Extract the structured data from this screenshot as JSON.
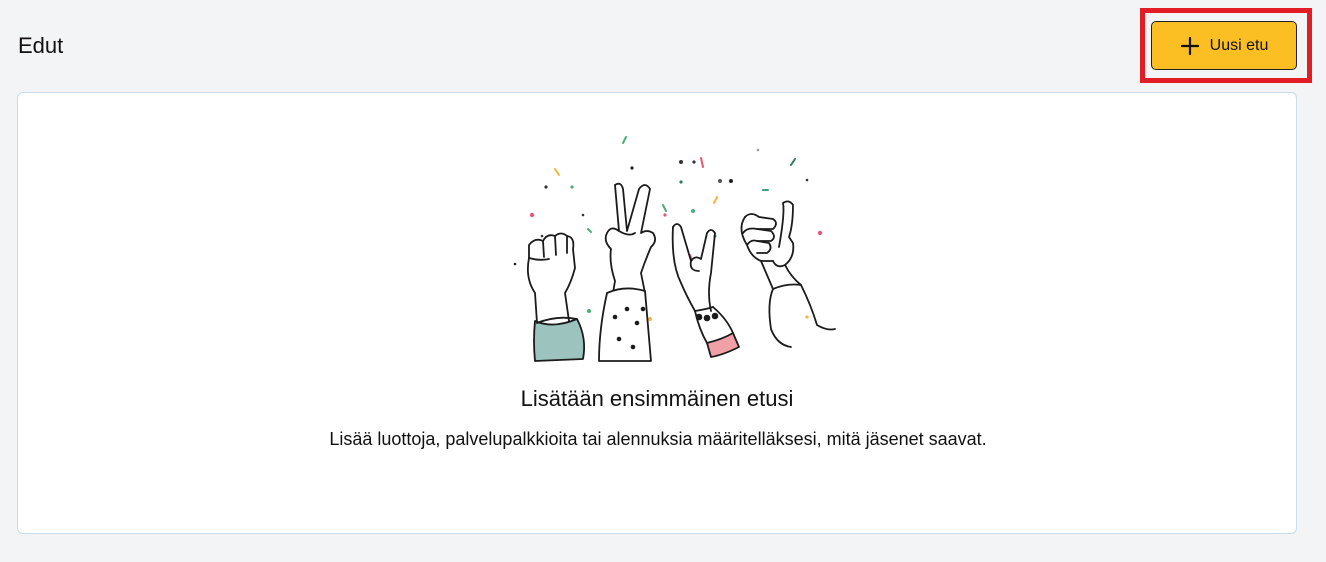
{
  "header": {
    "title": "Edut",
    "new_button_label": "Uusi etu",
    "new_button_icon": "plus-icon",
    "button_color": "#fbbf24",
    "highlight_color": "#e11d26"
  },
  "empty_state": {
    "title": "Lisätään ensimmäinen etusi",
    "description": "Lisää luottoja, palvelupalkkioita tai alennuksia määritelläksesi, mitä jäsenet saavat.",
    "illustration": "celebrating-hands-illustration"
  }
}
